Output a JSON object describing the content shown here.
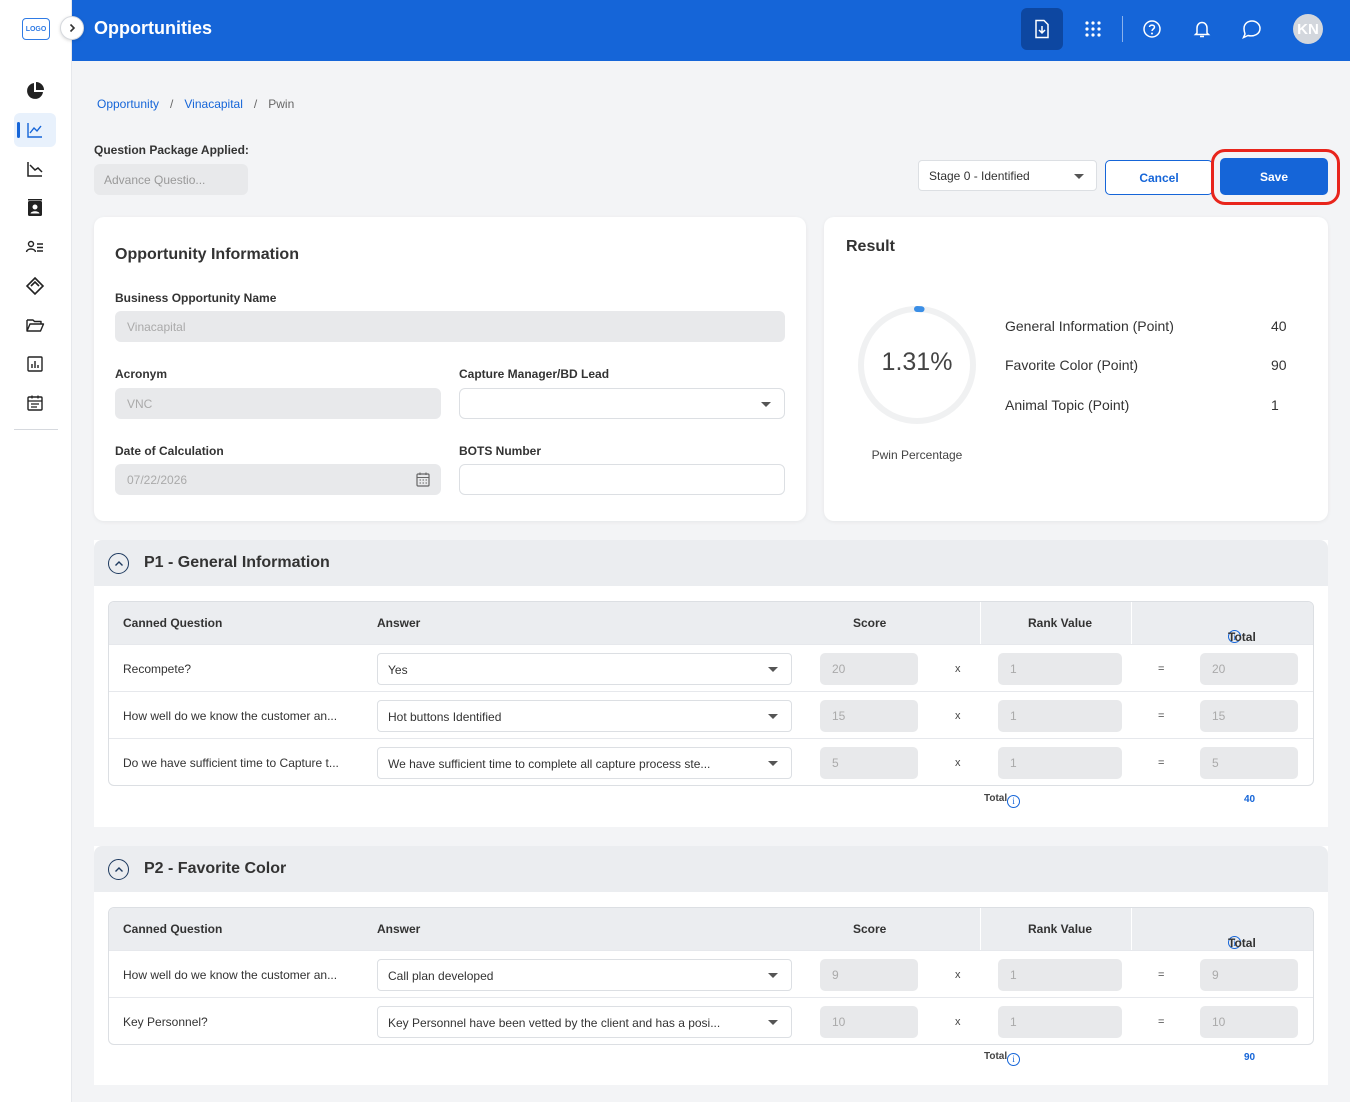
{
  "app": {
    "logo_text": "LOGO",
    "page_title": "Opportunities",
    "avatar_initials": "KN",
    "accent": "#1565d8"
  },
  "breadcrumb": {
    "items": [
      "Opportunity",
      "Vinacapital"
    ],
    "current": "Pwin",
    "separator": "/"
  },
  "question_package": {
    "label": "Question Package Applied:",
    "value": "Advance Questio..."
  },
  "stage": {
    "value": "Stage 0 - Identified"
  },
  "buttons": {
    "cancel": "Cancel",
    "save": "Save"
  },
  "opportunity_info": {
    "title": "Opportunity Information",
    "business_name_label": "Business Opportunity Name",
    "business_name_value": "Vinacapital",
    "acronym_label": "Acronym",
    "acronym_value": "VNC",
    "capture_manager_label": "Capture Manager/BD Lead",
    "capture_manager_value": "",
    "date_label": "Date of Calculation",
    "date_value": "07/22/2026",
    "bots_label": "BOTS Number",
    "bots_value": ""
  },
  "result": {
    "title": "Result",
    "percentage": "1.31%",
    "percentage_value": 1.31,
    "percentage_label": "Pwin Percentage",
    "rows": [
      {
        "label": "General Information (Point)",
        "value": "40"
      },
      {
        "label": "Favorite Color (Point)",
        "value": "90"
      },
      {
        "label": "Animal Topic (Point)",
        "value": "1"
      }
    ]
  },
  "table_headers": {
    "question": "Canned Question",
    "answer": "Answer",
    "score": "Score",
    "rank": "Rank Value",
    "total": "Total",
    "multiply": "x",
    "equals": "=",
    "footer_total": "Total"
  },
  "sections": [
    {
      "title": "P1 - General Information",
      "rows": [
        {
          "question": "Recompete?",
          "answer": "Yes",
          "score": "20",
          "rank": "1",
          "total": "20"
        },
        {
          "question": "How well do we know the customer an...",
          "answer": "Hot buttons Identified",
          "score": "15",
          "rank": "1",
          "total": "15"
        },
        {
          "question": "Do we have sufficient time to Capture t...",
          "answer": "We have sufficient time to complete all capture process ste...",
          "score": "5",
          "rank": "1",
          "total": "5"
        }
      ],
      "grand_total": "40"
    },
    {
      "title": "P2 - Favorite Color",
      "rows": [
        {
          "question": "How well do we know the customer an...",
          "answer": "Call plan developed",
          "score": "9",
          "rank": "1",
          "total": "9"
        },
        {
          "question": "Key Personnel?",
          "answer": "Key Personnel have been vetted by the client and has a posi...",
          "score": "10",
          "rank": "1",
          "total": "10"
        }
      ],
      "grand_total": "90"
    }
  ]
}
